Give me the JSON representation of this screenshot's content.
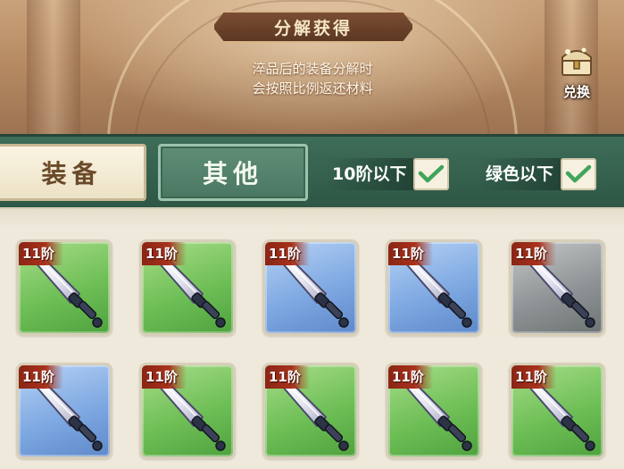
{
  "banner": {
    "title": "分解获得",
    "desc_line1": "淬品后的装备分解时",
    "desc_line2": "会按照比例返还材料",
    "exchange_label": "兑换",
    "exchange_icon": "treasure-chest-icon"
  },
  "tabs": {
    "equip": "装备",
    "other": "其他",
    "active": "other"
  },
  "filters": [
    {
      "label": "10阶以下",
      "checked": true
    },
    {
      "label": "绿色以下",
      "checked": true
    }
  ],
  "colors": {
    "green": "#6fbf57",
    "blue": "#7fa9e2",
    "gray": "#8f9496",
    "tier_badge": "#a8321c",
    "check": "#3fa55b"
  },
  "items": [
    {
      "tier": "11阶",
      "rarity": "green",
      "icon": "sword-icon"
    },
    {
      "tier": "11阶",
      "rarity": "green",
      "icon": "sword-icon"
    },
    {
      "tier": "11阶",
      "rarity": "blue",
      "icon": "sword-icon"
    },
    {
      "tier": "11阶",
      "rarity": "blue",
      "icon": "sword-icon"
    },
    {
      "tier": "11阶",
      "rarity": "gray",
      "icon": "sword-icon"
    },
    {
      "tier": "11阶",
      "rarity": "blue",
      "icon": "sword-icon"
    },
    {
      "tier": "11阶",
      "rarity": "green",
      "icon": "sword-icon"
    },
    {
      "tier": "11阶",
      "rarity": "green",
      "icon": "sword-icon"
    },
    {
      "tier": "11阶",
      "rarity": "green",
      "icon": "sword-icon"
    },
    {
      "tier": "11阶",
      "rarity": "green",
      "icon": "sword-icon"
    }
  ]
}
